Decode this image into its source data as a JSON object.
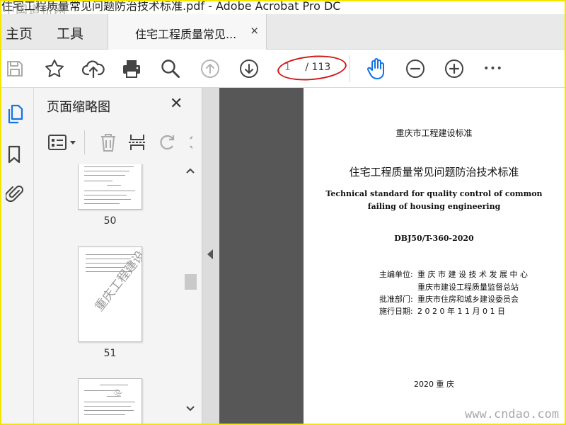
{
  "window": {
    "title": "住宅工程质量常见问题防治技术标准.pdf - Adobe Acrobat Pro DC"
  },
  "watermarks": {
    "top_left": "中国道桥网",
    "bottom_right": "www.cndao.com"
  },
  "nav": {
    "home": "主页",
    "tools": "工具"
  },
  "doc_tab": {
    "label": "住宅工程质量常见...",
    "close": "×"
  },
  "toolbar": {
    "page_current": "1",
    "page_total": "/ 113",
    "more": "•••"
  },
  "panel": {
    "title": "页面缩略图",
    "close": "✕",
    "thumbnails": [
      {
        "number": "50"
      },
      {
        "number": "51",
        "stamp": "重庆工程建设"
      },
      {
        "number": "",
        "stamp": "设"
      }
    ]
  },
  "document": {
    "standard_type": "重庆市工程建设标准",
    "title_cn": "住宅工程质量常见问题防治技术标准",
    "title_en_1": "Technical standard for quality control of common",
    "title_en_2": "failing of housing engineering",
    "code": "DBJ50/T-360-2020",
    "editor_label": "主编单位:",
    "editor_1": "重 庆 市 建 设 技 术 发 展 中 心",
    "editor_2": "重庆市建设工程质量监督总站",
    "approver_label": "批准部门:",
    "approver": "重庆市住房和城乡建设委员会",
    "date_label": "施行日期:",
    "date": "2 0 2 0  年  1 1  月  0 1  日",
    "footer": "2020    重    庆"
  },
  "colors": {
    "accent": "#1473e6",
    "annotation": "#d01818",
    "frame": "#f2e600",
    "viewer_bg": "#575757"
  }
}
